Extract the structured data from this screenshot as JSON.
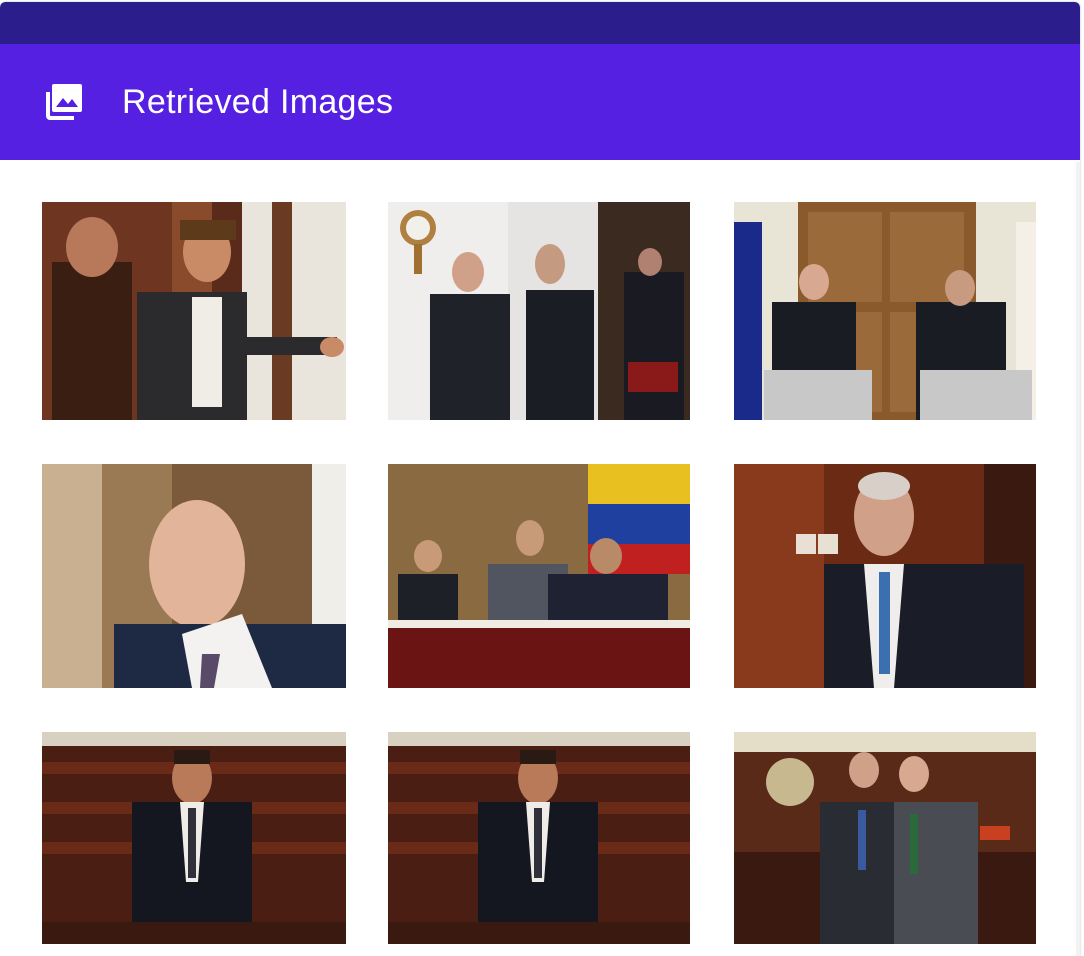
{
  "header": {
    "title": "Retrieved Images",
    "icon": "photo-library-icon",
    "strip_color": "#2b1d8b",
    "background_color": "#5520e2"
  },
  "gallery": {
    "columns": 3,
    "images": [
      {
        "id": "image-1",
        "description": "two men, one with long hair, in a wood-panelled room"
      },
      {
        "id": "image-2",
        "description": "two men in suits walking past a guard"
      },
      {
        "id": "image-3",
        "description": "two men at podiums in front of wooden doors with flags"
      },
      {
        "id": "image-4",
        "description": "bald man in navy suit speaking"
      },
      {
        "id": "image-5",
        "description": "men seated at a table in front of a flag"
      },
      {
        "id": "image-6",
        "description": "grey-haired man in suit smiling"
      },
      {
        "id": "image-7",
        "description": "man speaking at a lectern in a wooden chamber"
      },
      {
        "id": "image-8",
        "description": "man speaking at a lectern in a wooden chamber"
      },
      {
        "id": "image-9",
        "description": "two men posing in a courtroom"
      }
    ]
  }
}
